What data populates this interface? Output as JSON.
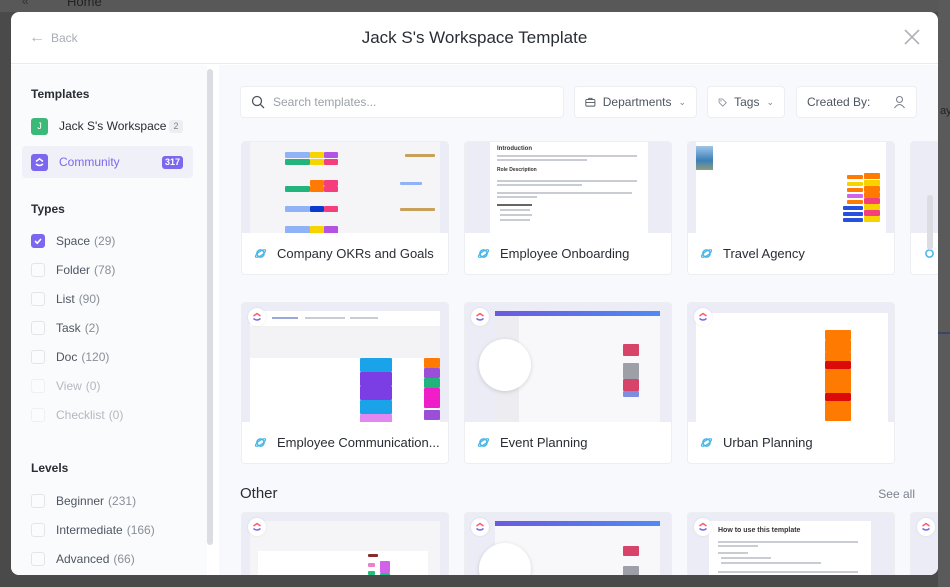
{
  "background": {
    "page_title": "Home",
    "right_text": "ay"
  },
  "modal": {
    "title": "Jack S's Workspace Template",
    "back_label": "Back"
  },
  "sidebar": {
    "templates_heading": "Templates",
    "templates": [
      {
        "label": "Jack S's Workspace",
        "count": "2",
        "icon_letter": "J",
        "icon_color": "#3cb878",
        "active": false
      },
      {
        "label": "Community",
        "count": "317",
        "icon_color": "#7b68ee",
        "active": true
      }
    ],
    "types_heading": "Types",
    "types": [
      {
        "label": "Space",
        "count": "(29)",
        "checked": true,
        "disabled": false
      },
      {
        "label": "Folder",
        "count": "(78)",
        "checked": false,
        "disabled": false
      },
      {
        "label": "List",
        "count": "(90)",
        "checked": false,
        "disabled": false
      },
      {
        "label": "Task",
        "count": "(2)",
        "checked": false,
        "disabled": false
      },
      {
        "label": "Doc",
        "count": "(120)",
        "checked": false,
        "disabled": false
      },
      {
        "label": "View",
        "count": "(0)",
        "checked": false,
        "disabled": true
      },
      {
        "label": "Checklist",
        "count": "(0)",
        "checked": false,
        "disabled": true
      }
    ],
    "levels_heading": "Levels",
    "levels": [
      {
        "label": "Beginner",
        "count": "(231)",
        "checked": false
      },
      {
        "label": "Intermediate",
        "count": "(166)",
        "checked": false
      },
      {
        "label": "Advanced",
        "count": "(66)",
        "checked": false
      }
    ]
  },
  "toolbar": {
    "search_placeholder": "Search templates...",
    "search_value": "",
    "departments_label": "Departments",
    "tags_label": "Tags",
    "created_by_label": "Created By:"
  },
  "cards": [
    {
      "name": "Company OKRs and Goals"
    },
    {
      "name": "Employee Onboarding"
    },
    {
      "name": "Travel Agency"
    },
    {
      "name": "Employee Communication..."
    },
    {
      "name": "Event Planning"
    },
    {
      "name": "Urban Planning"
    }
  ],
  "previews": {
    "onboarding_heading": "Introduction",
    "onboarding_subheading": "Role Description",
    "how_to_heading": "How to use this template"
  },
  "other_section": {
    "title": "Other",
    "see_all": "See all"
  },
  "colors": {
    "accent": "#7b68ee",
    "workspace_green": "#3cb878",
    "space_icon": "#49b5e7"
  }
}
